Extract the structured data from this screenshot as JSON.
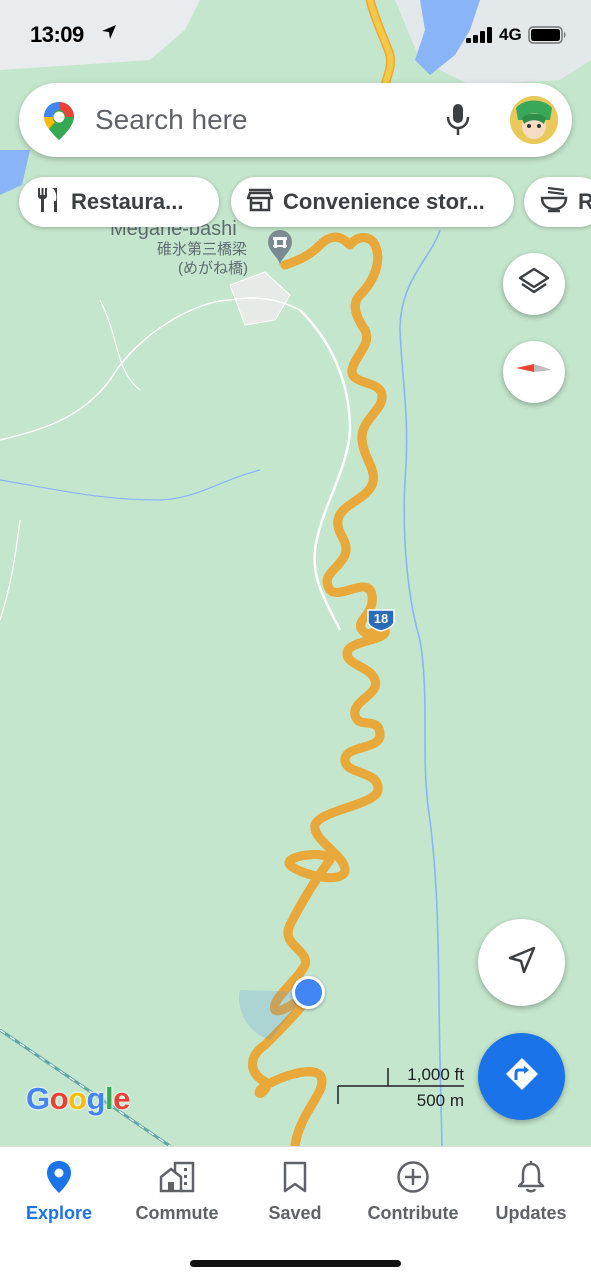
{
  "status_bar": {
    "time": "13:09",
    "network": "4G"
  },
  "search": {
    "placeholder": "Search here",
    "pin_icon": "maps-pin-icon",
    "mic_icon": "microphone-icon"
  },
  "chips": [
    {
      "label": "Restaura...",
      "icon": "fork-knife-icon"
    },
    {
      "label": "Convenience stor...",
      "icon": "store-icon"
    },
    {
      "label": "R",
      "icon": "ramen-bowl-icon"
    }
  ],
  "map": {
    "place_name_latin": "Megane-bashi",
    "place_name_kanji": "碓氷第三橋梁",
    "place_name_kana": "(めがね橋)",
    "route_badge": "18",
    "scale_imperial": "1,000 ft",
    "scale_metric": "500 m",
    "attribution": "Google",
    "colors": {
      "land": "#c4e6cc",
      "road": "#f7c844",
      "road_edge": "#e8a93a",
      "water": "#8ab4f8",
      "location": "#4285f4",
      "accent": "#1a73e8"
    }
  },
  "controls": {
    "layers_icon": "layers-icon",
    "compass_icon": "compass-icon",
    "recenter_icon": "navigation-arrow-icon",
    "directions_icon": "directions-icon"
  },
  "tabs": [
    {
      "label": "Explore",
      "icon": "location-pin-icon",
      "active": true
    },
    {
      "label": "Commute",
      "icon": "buildings-icon",
      "active": false
    },
    {
      "label": "Saved",
      "icon": "bookmark-icon",
      "active": false
    },
    {
      "label": "Contribute",
      "icon": "plus-circle-icon",
      "active": false
    },
    {
      "label": "Updates",
      "icon": "bell-icon",
      "active": false
    }
  ]
}
